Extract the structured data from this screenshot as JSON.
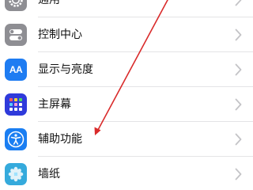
{
  "settings": {
    "items": [
      {
        "label": "通用",
        "icon": "gear-icon",
        "color": "#8e8e93"
      },
      {
        "label": "控制中心",
        "icon": "toggle-switches-icon",
        "color": "#8e8e93"
      },
      {
        "label": "显示与亮度",
        "icon": "text-size-aa-icon",
        "color": "#1e7cf2",
        "icon_text": "AA"
      },
      {
        "label": "主屏幕",
        "icon": "home-grid-icon",
        "color": "#2f3adb"
      },
      {
        "label": "辅助功能",
        "icon": "accessibility-person-icon",
        "color": "#1a7ef2"
      },
      {
        "label": "墙纸",
        "icon": "flower-icon",
        "color": "#35aadc"
      }
    ]
  },
  "annotation": {
    "arrow_color": "#d92b2b"
  }
}
